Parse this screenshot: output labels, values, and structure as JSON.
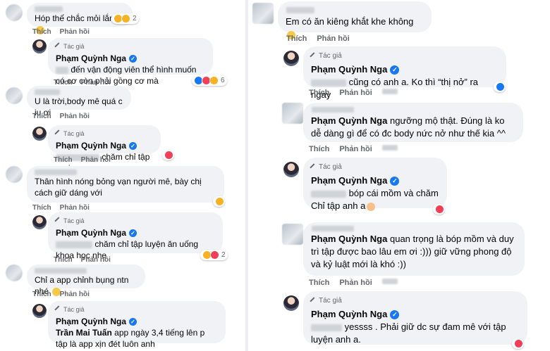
{
  "left_column": {
    "comments": [
      {
        "text": "Hóp thế chắc mỏi lắm",
        "reaction_count": "2"
      },
      {
        "author_badge": "Tác giả",
        "name": "Phạm Quỳnh Nga",
        "text": "đến vận động viên thể hình muốn có cơ còn phải gồng cơ mà",
        "reaction_count": "6"
      },
      {
        "text": "U là trời,body mê quá c iu ơi"
      },
      {
        "author_badge": "Tác giả",
        "name": "Phạm Quỳnh Nga",
        "text": "chăm chỉ tập e ơi"
      },
      {
        "text": "Thân hình nóng bỏng vạn người mê, bày chị cách giữ dáng với"
      },
      {
        "author_badge": "Tác giả",
        "name": "Phạm Quỳnh Nga",
        "text": "chăm chỉ tập luyện ăn uống khoa học nhe",
        "reaction_count": "2"
      },
      {
        "text": "Chỉ a app chỉnh bụng ntn nhé"
      },
      {
        "author_badge": "Tác giả",
        "name": "Phạm Quỳnh Nga",
        "tag": "Trần Mai Tuấn",
        "text": "app ngày 3,4 tiếng lên p tập là app xịn đét luôn anh"
      }
    ],
    "like_label": "Thích",
    "reply_label": "Phản hồi"
  },
  "right_column": {
    "comments": [
      {
        "text": "Em có ăn kiêng khắt khe không"
      },
      {
        "author_badge": "Tác giả",
        "name": "Phạm Quỳnh Nga",
        "text": "cũng có anh a. Ko thì “thị nở” ra ngay"
      },
      {
        "name": "Phạm Quỳnh Nga",
        "text": "ngưỡng mộ thật. Đúng là ko dễ dàng gì để có đc body nức nở như thế kia ^^"
      },
      {
        "author_badge": "Tác giả",
        "name": "Phạm Quỳnh Nga",
        "text": "bóp cái mồm và chăm",
        "text2": "Chỉ tập anh a"
      },
      {
        "name": "Phạm Quỳnh Nga",
        "text": "quan trọng là bóp mồm và duy trì tập được bao lâu em ơi :))) giữ vững phong độ và kỷ luật mới là khó :))"
      },
      {
        "author_badge": "Tác giả",
        "name": "Phạm Quỳnh Nga",
        "text": "yessss . Phải giữ dc sự đam mê với tập luyện anh a."
      }
    ],
    "like_label": "Thích",
    "reply_label": "Phản hồi"
  },
  "colors": {
    "verified": "#1877f2",
    "bubble": "#f0f2f5",
    "meta": "#65676b"
  }
}
